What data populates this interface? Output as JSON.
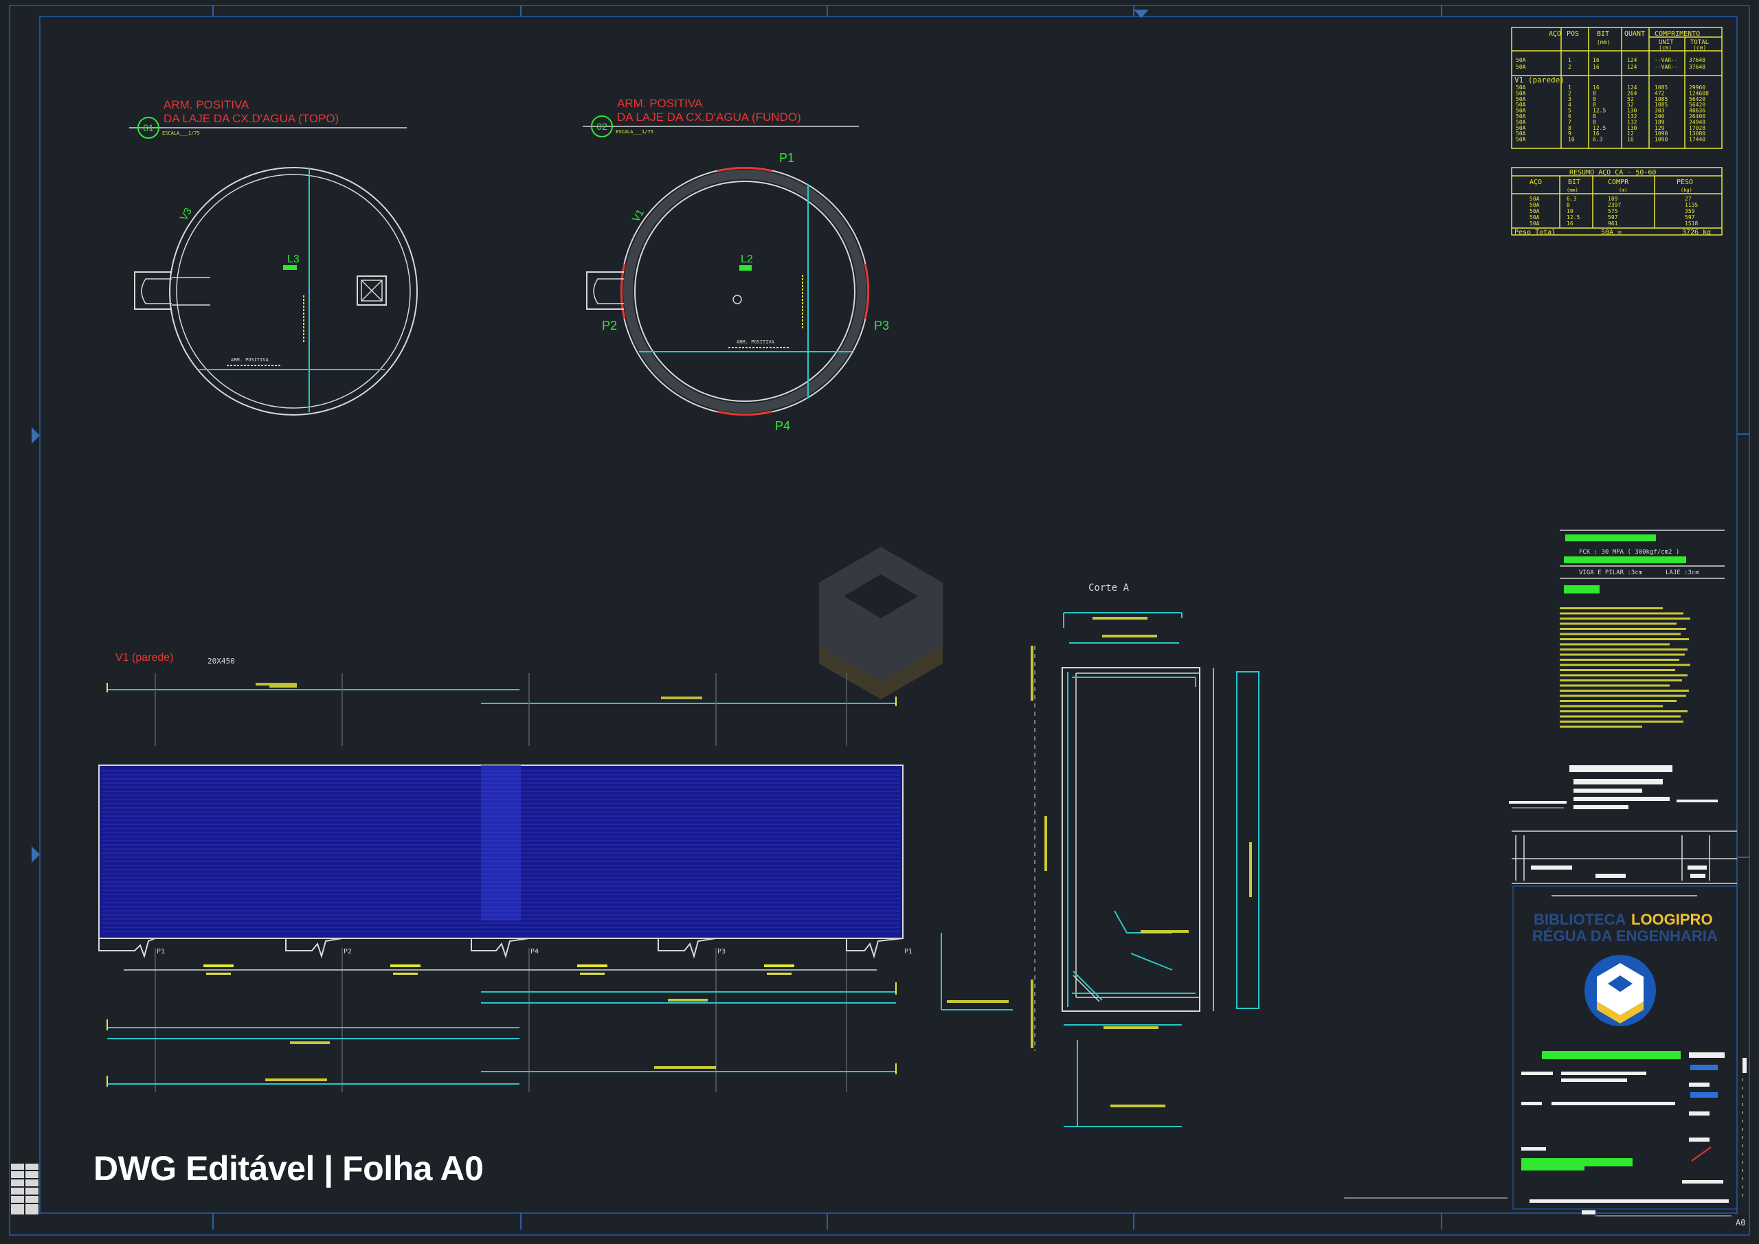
{
  "caption": "DWG Editável | Folha A0",
  "sheet_label": "A0",
  "colors": {
    "background": "#1d2229",
    "border": "#1f4f8a",
    "cyan": "#28c8c8",
    "yellow": "#e6e63a",
    "red": "#e8362f",
    "green": "#2fe82f",
    "white": "#d8d8d8",
    "hatch_blue": "#1a1fa8"
  },
  "plans": [
    {
      "number": "01",
      "title_line1": "ARM. POSITIVA",
      "title_line2": "DA LAJE DA CX.D'AGUA (TOPO)",
      "scale": "ESCALA___1/75",
      "wall_label": "V3",
      "slab_label": "L3",
      "note": "ARM. POSITIVA"
    },
    {
      "number": "02",
      "title_line1": "ARM. POSITIVA",
      "title_line2": "DA LAJE DA CX.D'AGUA (FUNDO)",
      "scale": "ESCALA___1/75",
      "wall_label": "V1",
      "slab_label": "L2",
      "note": "ARM. POSITIVA",
      "pillars": [
        "P1",
        "P2",
        "P3",
        "P4"
      ]
    }
  ],
  "elevation": {
    "title": "V1 (parede)",
    "size": "20X450",
    "pillars": [
      "P1",
      "P2",
      "P4",
      "P3",
      "P1"
    ]
  },
  "section": {
    "title": "Corte A"
  },
  "steel_table": {
    "headers": [
      "AÇO",
      "POS",
      "BIT",
      "QUANT",
      "COMPRIMENTO"
    ],
    "subheaders": [
      "(mm)",
      "UNIT",
      "TOTAL",
      "(cm)",
      "(cm)"
    ],
    "group_label": "V1 (parede)",
    "top_rows": [
      [
        "50A",
        "1",
        "16",
        "124",
        "--VAR--",
        "37648"
      ],
      [
        "50A",
        "2",
        "16",
        "124",
        "--VAR--",
        "37648"
      ]
    ],
    "rows": [
      [
        "50A",
        "1",
        "16",
        "124",
        "1085",
        "29960"
      ],
      [
        "50A",
        "2",
        "8",
        "264",
        "472",
        "124608"
      ],
      [
        "50A",
        "3",
        "8",
        "52",
        "1085",
        "56420"
      ],
      [
        "50A",
        "4",
        "8",
        "52",
        "1085",
        "56420"
      ],
      [
        "50A",
        "5",
        "12.5",
        "130",
        "303",
        "40636"
      ],
      [
        "50A",
        "6",
        "8",
        "132",
        "200",
        "26400"
      ],
      [
        "50A",
        "7",
        "8",
        "132",
        "189",
        "24948"
      ],
      [
        "50A",
        "8",
        "12.5",
        "130",
        "129",
        "17028"
      ],
      [
        "50A",
        "9",
        "16",
        "12",
        "1090",
        "13080"
      ],
      [
        "50A",
        "10",
        "6.3",
        "16",
        "1090",
        "17440"
      ]
    ]
  },
  "summary_table": {
    "title": "RESUMO AÇO CA - 50-60",
    "headers": [
      "AÇO",
      "BIT",
      "COMPR",
      "PESO"
    ],
    "subheaders": [
      "(mm)",
      "(m)",
      "(kg)"
    ],
    "rows": [
      [
        "50A",
        "6.3",
        "109",
        "27"
      ],
      [
        "50A",
        "8",
        "2397",
        "1135"
      ],
      [
        "50A",
        "10",
        "575",
        "359"
      ],
      [
        "50A",
        "12.5",
        "597",
        "597"
      ],
      [
        "50A",
        "16",
        "961",
        "1518"
      ]
    ],
    "total_label": "Peso Total",
    "total_steel": "50A =",
    "total_value": "3726 kg"
  },
  "specs": {
    "fck": "FCK : 30 MPA ( 300kgf/cm2 )",
    "cover": "VIGA E PILAR :3cm",
    "cover_slab": "LAJE :3cm"
  },
  "logo": {
    "line1_a": "BIBLIOTECA",
    "line1_b": "LOOGIPRO",
    "line2": "RÉGUA DA ENGENHARIA"
  }
}
